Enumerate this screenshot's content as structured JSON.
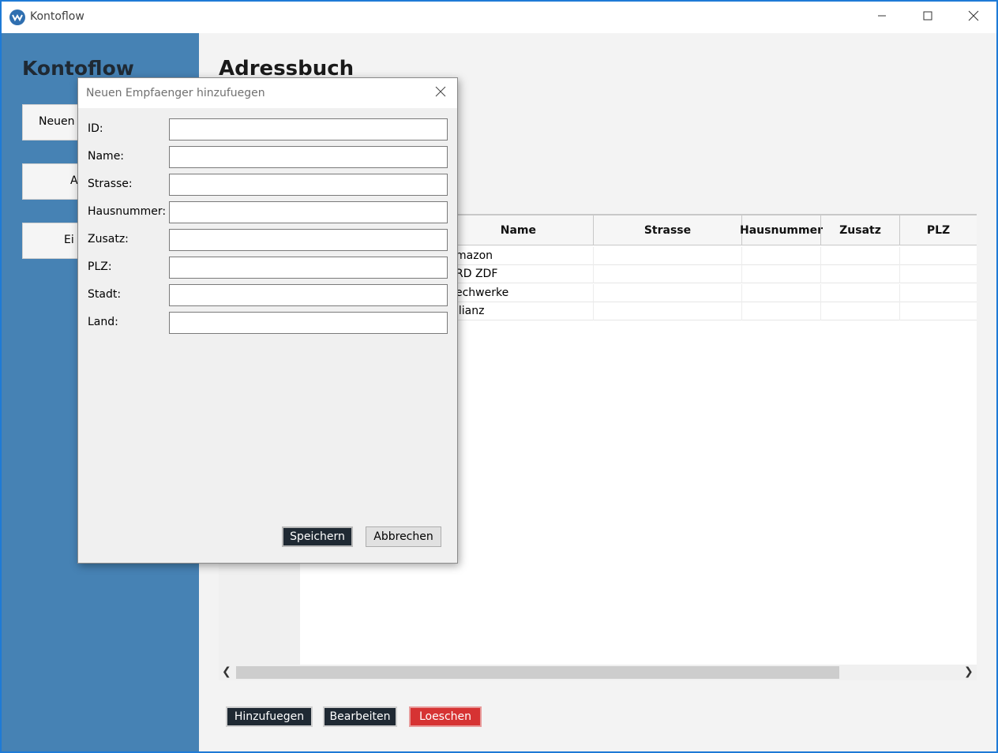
{
  "window": {
    "title": "Kontoflow"
  },
  "sidebar": {
    "brand": "Kontoflow",
    "buttons": [
      {
        "label": "Neuen"
      },
      {
        "label": "A"
      },
      {
        "label": "Ei"
      }
    ]
  },
  "main": {
    "title": "Adressbuch",
    "table": {
      "columns": [
        "Name",
        "Strasse",
        "Hausnummer",
        "Zusatz",
        "PLZ"
      ],
      "rows": [
        {
          "name": "mazon",
          "strasse": "",
          "hausnummer": "",
          "zusatz": "",
          "plz": ""
        },
        {
          "name": "RD ZDF",
          "strasse": "",
          "hausnummer": "",
          "zusatz": "",
          "plz": ""
        },
        {
          "name": "echwerke",
          "strasse": "",
          "hausnummer": "",
          "zusatz": "",
          "plz": ""
        },
        {
          "name": "llianz",
          "strasse": "",
          "hausnummer": "",
          "zusatz": "",
          "plz": ""
        }
      ]
    },
    "actions": {
      "add": "Hinzufuegen",
      "edit": "Bearbeiten",
      "delete": "Loeschen"
    }
  },
  "dialog": {
    "title": "Neuen Empfaenger hinzufuegen",
    "fields": [
      {
        "label": "ID:",
        "value": ""
      },
      {
        "label": "Name:",
        "value": ""
      },
      {
        "label": "Strasse:",
        "value": ""
      },
      {
        "label": "Hausnummer:",
        "value": ""
      },
      {
        "label": "Zusatz:",
        "value": ""
      },
      {
        "label": "PLZ:",
        "value": ""
      },
      {
        "label": "Stadt:",
        "value": ""
      },
      {
        "label": "Land:",
        "value": ""
      }
    ],
    "save": "Speichern",
    "cancel": "Abbrechen"
  },
  "colors": {
    "sidebar": "#4682b4",
    "dark_button": "#1f2933",
    "delete_button": "#d63333",
    "window_border": "#1e7ad6"
  },
  "icons": {
    "app": "app-logo-icon",
    "minimize": "minimize-icon",
    "maximize": "maximize-icon",
    "close": "close-icon"
  }
}
